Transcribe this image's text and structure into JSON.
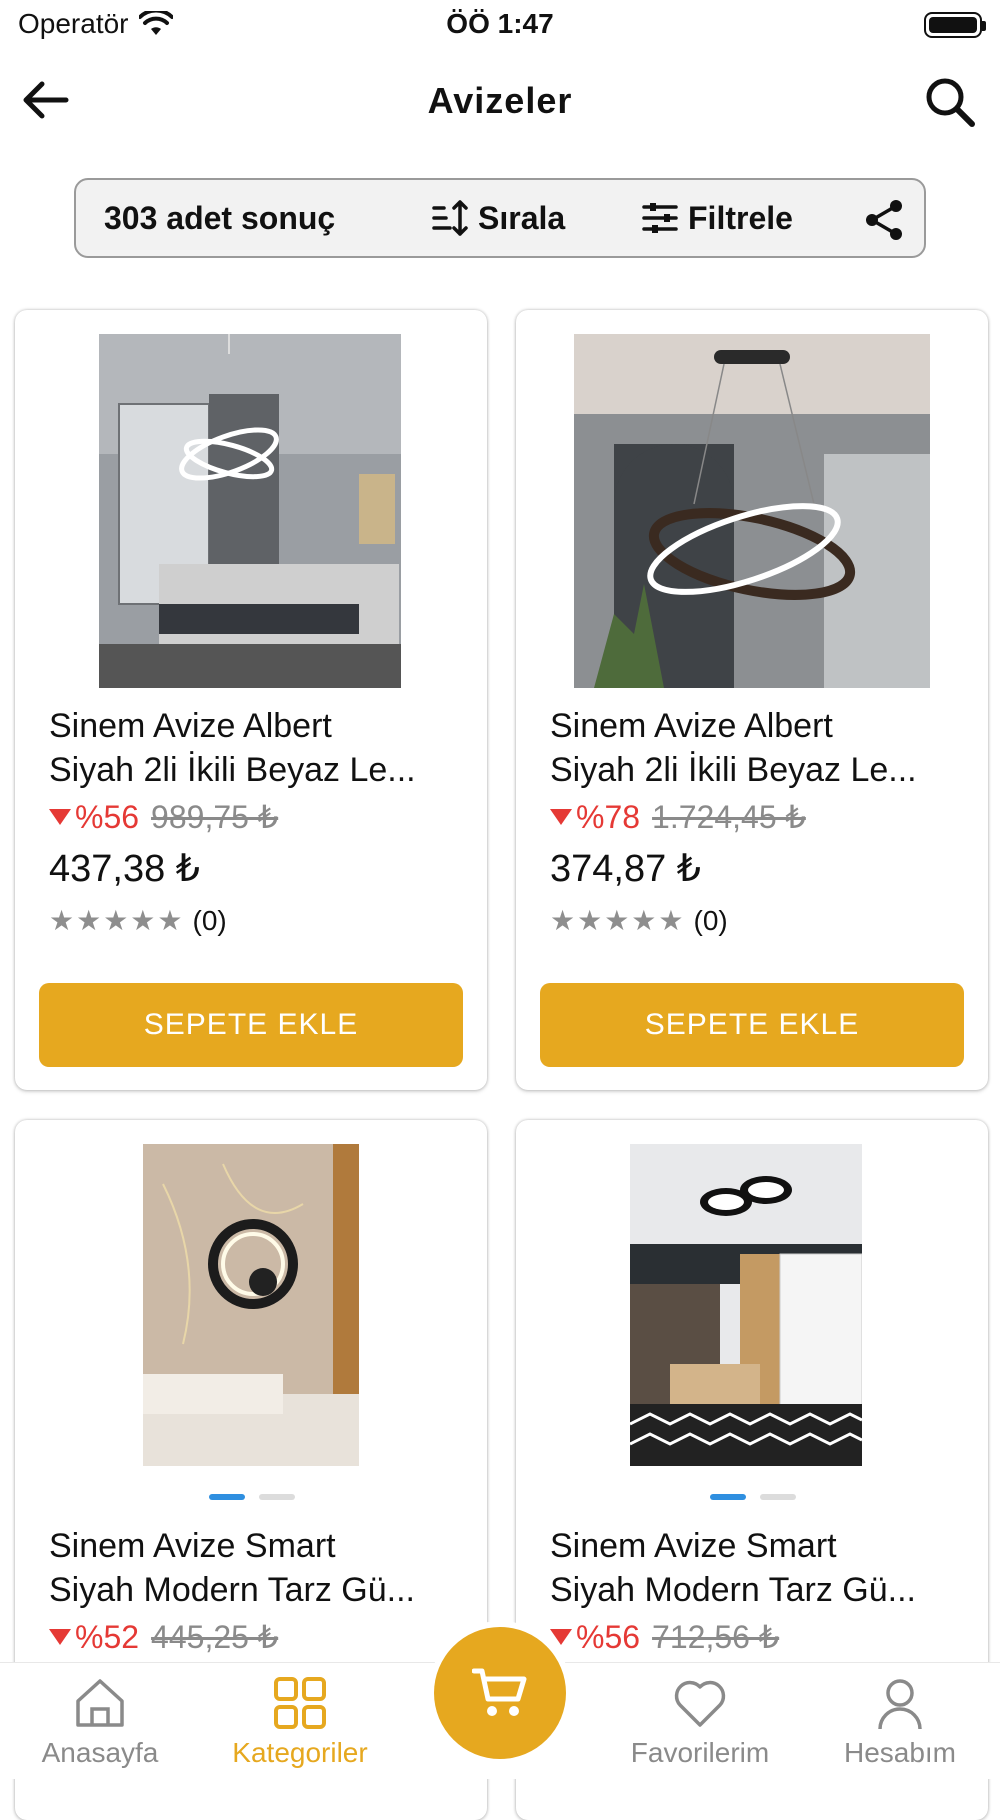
{
  "status_bar": {
    "carrier": "Operatör",
    "time": "ÖÖ 1:47"
  },
  "nav": {
    "title": "Avizeler"
  },
  "toolbar": {
    "result_count": "303 adet sonuç",
    "sort_label": "Sırala",
    "filter_label": "Filtrele"
  },
  "products": [
    {
      "name_line1": "Sinem Avize Albert",
      "name_line2": "Siyah 2li İkili Beyaz Le...",
      "discount": "%56",
      "old_price": "989,75 ₺",
      "price": "437,38 ₺",
      "stars": "★★★★★",
      "review_count": "(0)",
      "button": "SEPETE EKLE"
    },
    {
      "name_line1": "Sinem Avize Albert",
      "name_line2": "Siyah 2li İkili Beyaz Le...",
      "discount": "%78",
      "old_price": "1.724,45 ₺",
      "price": "374,87 ₺",
      "stars": "★★★★★",
      "review_count": "(0)",
      "button": "SEPETE EKLE"
    },
    {
      "name_line1": "Sinem Avize Smart",
      "name_line2": "Siyah Modern Tarz Gü...",
      "discount": "%52",
      "old_price": "445,25 ₺"
    },
    {
      "name_line1": "Sinem Avize Smart",
      "name_line2": "Siyah Modern Tarz Gü...",
      "discount": "%56",
      "old_price": "712,56 ₺"
    }
  ],
  "tab_bar": {
    "home": "Anasayfa",
    "categories": "Kategoriler",
    "favorites": "Favorilerim",
    "account": "Hesabım"
  },
  "colors": {
    "accent": "#e6a81f",
    "discount": "#e53935",
    "carousel_active": "#2f8fe0"
  },
  "icons": [
    "back-arrow-icon",
    "search-icon",
    "sort-icon",
    "filter-icon",
    "share-icon",
    "star-icon",
    "home-icon",
    "grid-icon",
    "cart-icon",
    "heart-icon",
    "user-icon",
    "wifi-icon",
    "battery-icon"
  ]
}
